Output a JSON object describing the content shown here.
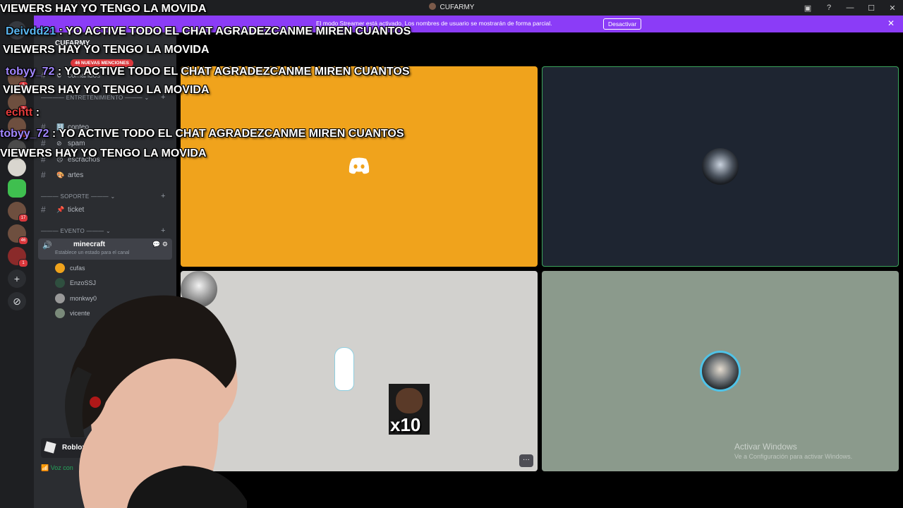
{
  "window": {
    "title": "CUFARMY"
  },
  "banner": {
    "text": "El modo Streamer está activado. Los nombres de usuario se mostrarán de forma parcial.",
    "button": "Desactivar"
  },
  "server": {
    "name": "CUFARMY",
    "mentions": "46 NUEVAS MENCIONES"
  },
  "channels": [
    {
      "name": "comandos"
    },
    {
      "name": "conteo"
    },
    {
      "name": "spam"
    },
    {
      "name": "escrachos"
    },
    {
      "name": "artes"
    },
    {
      "name": "ticket"
    }
  ],
  "categories": {
    "entretenimiento": "ENTRETENIMIENTO",
    "soporte": "SOPORTE",
    "evento": "EVENTO"
  },
  "voice_channel": {
    "name": "minecraft",
    "status": "Establece un estado para el canal"
  },
  "voice_users": [
    "cufas",
    "EnzoSSJ",
    "monkwy0",
    "vicente"
  ],
  "server_badges": [
    "6",
    "2",
    "6",
    "17",
    "46",
    "1"
  ],
  "game": {
    "name": "Roblox"
  },
  "voice_status": "Voz con",
  "tiles": {
    "meme_text": "x10",
    "watermark": "Activar Windows",
    "watermark_sub": "Ve a Configuración para activar Windows."
  },
  "chat": [
    {
      "user": "",
      "text": "VIEWERS HAY YO TENGO LA MOVIDA"
    },
    {
      "user": "Deivdd21",
      "text": ": YO ACTIVE TODO EL CHAT AGRADEZCANME MIREN CUANTOS"
    },
    {
      "user": "",
      "text": "VIEWERS HAY YO TENGO LA MOVIDA"
    },
    {
      "user": "tobyy_72",
      "text": ": YO ACTIVE TODO EL CHAT AGRADEZCANME MIREN CUANTOS"
    },
    {
      "user": "",
      "text": "VIEWERS HAY YO TENGO LA MOVIDA"
    },
    {
      "user": "echtt",
      "text": ":"
    },
    {
      "user": "tobyy_72",
      "text": ": YO ACTIVE TODO EL CHAT AGRADEZCANME MIREN CUANTOS"
    },
    {
      "user": "",
      "text": "VIEWERS HAY YO TENGO LA MOVIDA"
    }
  ]
}
